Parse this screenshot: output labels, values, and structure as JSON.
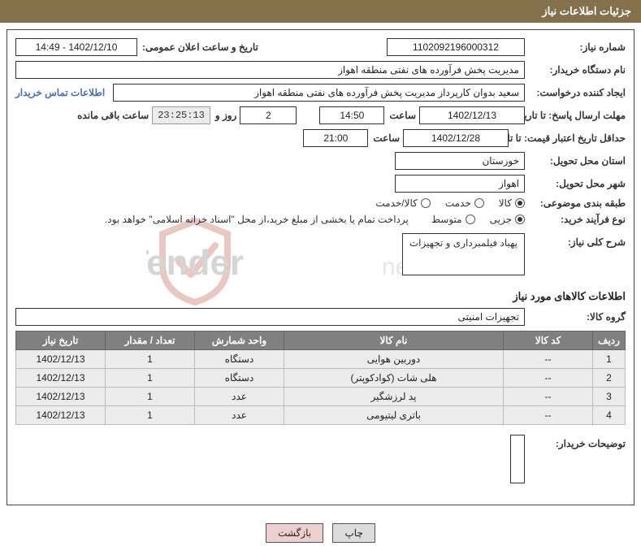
{
  "title": "جزئیات اطلاعات نیاز",
  "labels": {
    "need_no": "شماره نیاز:",
    "announce": "تاریخ و ساعت اعلان عمومی:",
    "buyer_org": "نام دستگاه خریدار:",
    "requester": "ایجاد کننده درخواست:",
    "contact_link": "اطلاعات تماس خریدار",
    "deadline": "مهلت ارسال پاسخ: تا تاریخ:",
    "time_word": "ساعت",
    "days_and": "روز و",
    "remaining": "ساعت باقی مانده",
    "price_validity": "حداقل تاریخ اعتبار قیمت: تا تاریخ:",
    "delivery_province": "استان محل تحویل:",
    "delivery_city": "شهر محل تحویل:",
    "category": "طبقه بندی موضوعی:",
    "purchase_type": "نوع فرآیند خرید:",
    "general_desc": "شرح کلی نیاز:",
    "items_info": "اطلاعات کالاهای مورد نیاز",
    "item_group": "گروه کالا:",
    "buyer_notes": "توضیحات خریدار:"
  },
  "values": {
    "need_no": "1102092196000312",
    "announce": "1402/12/10 - 14:49",
    "buyer_org": "مدیریت پخش فرآورده های نفتی منطقه اهواز",
    "requester": "سعید بدوان کارپرداز مدیریت پخش فرآورده های نفتی منطقه اهواز",
    "deadline_date": "1402/12/13",
    "deadline_time": "14:50",
    "days_left": "2",
    "time_left": "23:25:13",
    "price_validity_date": "1402/12/28",
    "price_validity_time": "21:00",
    "delivery_province": "خوزستان",
    "delivery_city": "اهواز",
    "general_desc": "پهباد فیلمبرداری و تجهیزات",
    "item_group": "تجهیزات امنیتی",
    "buyer_notes": ""
  },
  "category_options": {
    "goods": "کالا",
    "service": "خدمت",
    "both": "کالا/خدمت",
    "selected": "goods"
  },
  "purchase_options": {
    "minor": "جزیی",
    "medium": "متوسط",
    "selected": "minor",
    "note": "پرداخت تمام یا بخشی از مبلغ خرید،از محل \"اسناد خزانه اسلامی\" خواهد بود."
  },
  "columns": {
    "row": "ردیف",
    "code": "کد کالا",
    "name": "نام کالا",
    "unit": "واحد شمارش",
    "qty": "تعداد / مقدار",
    "date": "تاریخ نیاز"
  },
  "items": [
    {
      "row": "1",
      "code": "--",
      "name": "دوربین هوایی",
      "unit": "دستگاه",
      "qty": "1",
      "date": "1402/12/13"
    },
    {
      "row": "2",
      "code": "--",
      "name": "هلی شات (کوادکوپتر)",
      "unit": "دستگاه",
      "qty": "1",
      "date": "1402/12/13"
    },
    {
      "row": "3",
      "code": "--",
      "name": "پد لرزشگیر",
      "unit": "عدد",
      "qty": "1",
      "date": "1402/12/13"
    },
    {
      "row": "4",
      "code": "--",
      "name": "باتری لیتیومی",
      "unit": "عدد",
      "qty": "1",
      "date": "1402/12/13"
    }
  ],
  "buttons": {
    "print": "چاپ",
    "back": "بازگشت"
  },
  "watermark": "AriaTender.net"
}
